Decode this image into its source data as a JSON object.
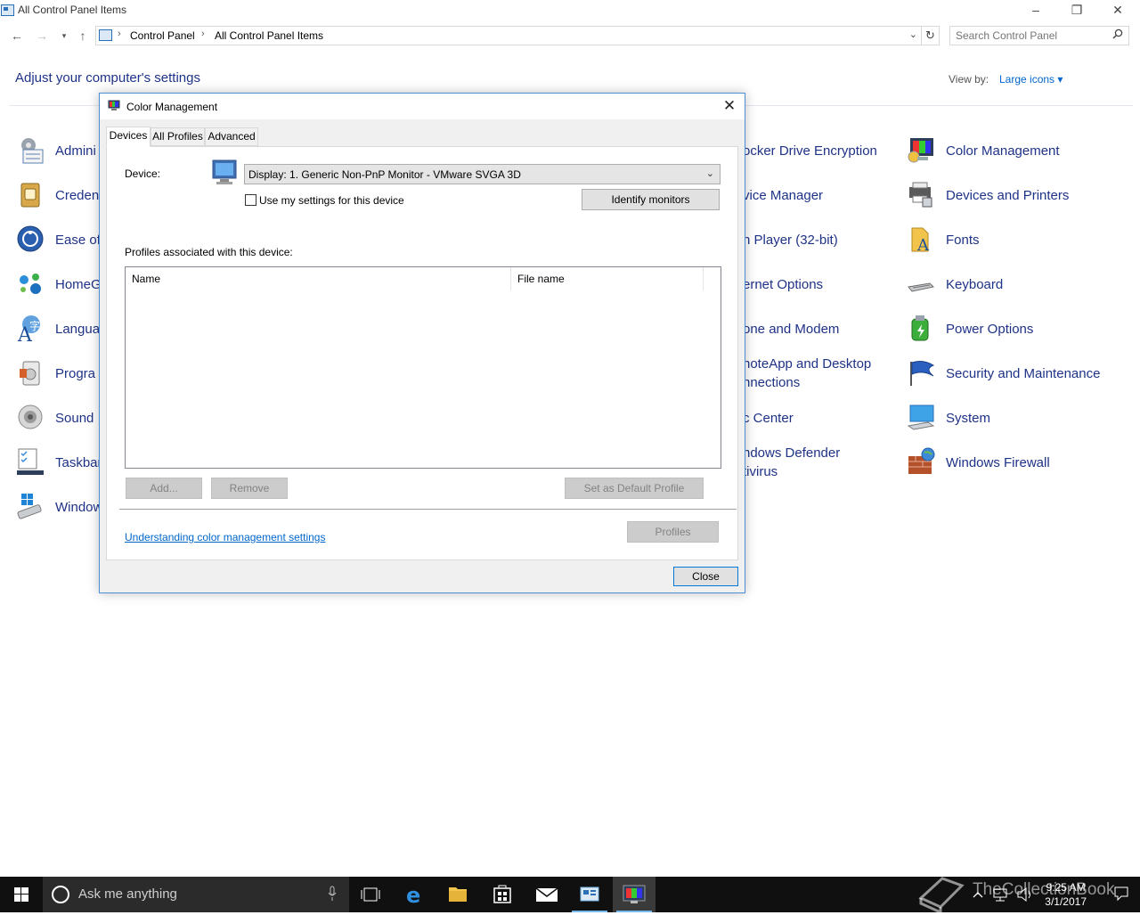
{
  "window": {
    "title": "All Control Panel Items"
  },
  "address": {
    "crumbs": [
      "Control Panel",
      "All Control Panel Items"
    ],
    "search_placeholder": "Search Control Panel"
  },
  "main": {
    "heading": "Adjust your computer's settings",
    "view_by_label": "View by:",
    "view_by_value": "Large icons ▾",
    "items": [
      {
        "label": "Admini",
        "icon": "administrative-tools-icon"
      },
      {
        "label": "Creden",
        "icon": "credential-manager-icon"
      },
      {
        "label": "Ease of",
        "icon": "ease-of-access-icon"
      },
      {
        "label": "HomeG",
        "icon": "homegroup-icon"
      },
      {
        "label": "Langua",
        "icon": "language-icon"
      },
      {
        "label": "Progra",
        "icon": "programs-icon"
      },
      {
        "label": "Sound",
        "icon": "sound-icon"
      },
      {
        "label": "Taskbar",
        "icon": "taskbar-icon"
      },
      {
        "label": "Window",
        "icon": "windows-to-go-icon"
      },
      {
        "label": "ocker Drive Encryption",
        "icon": "bitlocker-icon"
      },
      {
        "label": "vice Manager",
        "icon": "device-manager-icon"
      },
      {
        "label": "h Player (32-bit)",
        "icon": "flash-player-icon"
      },
      {
        "label": "ernet Options",
        "icon": "internet-options-icon"
      },
      {
        "label": "one and Modem",
        "icon": "phone-modem-icon"
      },
      {
        "label": "noteApp and Desktop",
        "label2": "nnections",
        "icon": "remoteapp-icon"
      },
      {
        "label": "c Center",
        "icon": "sync-center-icon"
      },
      {
        "label": "ndows Defender",
        "label2": "tivirus",
        "icon": "windows-defender-icon"
      },
      {
        "label": "Color Management",
        "icon": "color-management-icon"
      },
      {
        "label": "Devices and Printers",
        "icon": "devices-printers-icon"
      },
      {
        "label": "Fonts",
        "icon": "fonts-icon"
      },
      {
        "label": "Keyboard",
        "icon": "keyboard-icon"
      },
      {
        "label": "Power Options",
        "icon": "power-options-icon"
      },
      {
        "label": "Security and Maintenance",
        "icon": "security-maintenance-icon"
      },
      {
        "label": "System",
        "icon": "system-icon"
      },
      {
        "label": "Windows Firewall",
        "icon": "windows-firewall-icon"
      }
    ]
  },
  "dialog": {
    "title": "Color Management",
    "tabs": [
      "Devices",
      "All Profiles",
      "Advanced"
    ],
    "device_label": "Device:",
    "device_value": "Display: 1. Generic Non-PnP Monitor - VMware SVGA 3D",
    "use_settings_label": "Use my settings for this device",
    "identify_button": "Identify monitors",
    "profiles_label": "Profiles associated with this device:",
    "columns": [
      "Name",
      "File name"
    ],
    "add_button": "Add...",
    "remove_button": "Remove",
    "default_button": "Set as Default Profile",
    "profiles_button": "Profiles",
    "help_link": "Understanding color management settings",
    "close_button": "Close"
  },
  "taskbar": {
    "search_text": "Ask me anything",
    "time": "9:25 AM",
    "date": "3/1/2017"
  },
  "watermark": "TheCollectionBook"
}
